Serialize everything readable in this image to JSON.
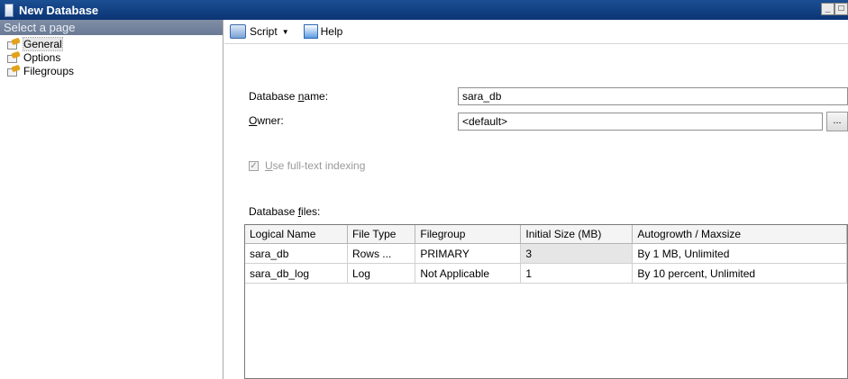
{
  "window": {
    "title": "New Database"
  },
  "sidebar": {
    "header": "Select a page",
    "items": [
      {
        "label": "General",
        "selected": true
      },
      {
        "label": "Options",
        "selected": false
      },
      {
        "label": "Filegroups",
        "selected": false
      }
    ]
  },
  "toolbar": {
    "script_label": "Script",
    "help_label": "Help"
  },
  "form": {
    "db_name_label_pre": "Database ",
    "db_name_label_u": "n",
    "db_name_label_post": "ame:",
    "db_name_value": "sara_db",
    "owner_label_u": "O",
    "owner_label_post": "wner:",
    "owner_value": "<default>",
    "ellipsis": "...",
    "fulltext_u": "U",
    "fulltext_post": "se full-text indexing",
    "files_label_pre": "Database ",
    "files_label_u": "f",
    "files_label_post": "iles:"
  },
  "grid": {
    "columns": [
      "Logical Name",
      "File Type",
      "Filegroup",
      "Initial Size (MB)",
      "Autogrowth / Maxsize"
    ],
    "rows": [
      {
        "logical_name": "sara_db",
        "file_type": "Rows ...",
        "filegroup": "PRIMARY",
        "initial_size": "3",
        "autogrowth": "By 1 MB, Unlimited"
      },
      {
        "logical_name": "sara_db_log",
        "file_type": "Log",
        "filegroup": "Not Applicable",
        "initial_size": "1",
        "autogrowth": "By 10 percent, Unlimited"
      }
    ]
  }
}
